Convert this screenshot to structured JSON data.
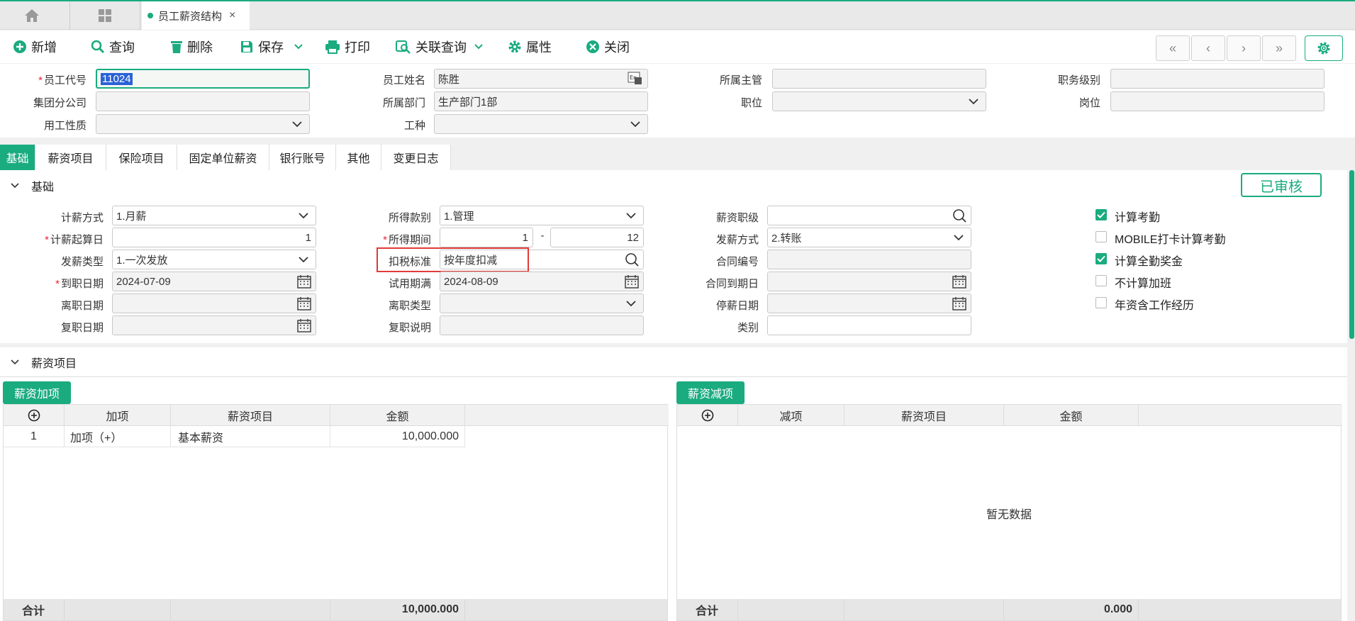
{
  "tabs": {
    "home_icon": "home-icon",
    "grid_icon": "grid-icon",
    "active_label": "员工薪资结构",
    "close_glyph": "×"
  },
  "toolbar": {
    "new_label": "新增",
    "query_label": "查询",
    "delete_label": "删除",
    "save_label": "保存",
    "print_label": "打印",
    "related_query_label": "关联查询",
    "properties_label": "属性",
    "close_label": "关闭",
    "nav": [
      "«",
      "‹",
      "›",
      "»"
    ]
  },
  "header": {
    "employee_code_label": "员工代号",
    "employee_code_value": "11024",
    "employee_name_label": "员工姓名",
    "employee_name_value": "陈胜",
    "supervisor_label": "所属主管",
    "supervisor_value": "",
    "job_level_label": "职务级别",
    "job_level_value": "",
    "branch_label": "集团分公司",
    "branch_value": "",
    "dept_label": "所属部门",
    "dept_value": "生产部门1部",
    "position_label": "职位",
    "position_value": "",
    "post_label": "岗位",
    "post_value": "",
    "employment_type_label": "用工性质",
    "employment_type_value": "",
    "work_type_label": "工种",
    "work_type_value": ""
  },
  "subtabs": [
    "基础",
    "薪资项目",
    "保险项目",
    "固定单位薪资",
    "银行账号",
    "其他",
    "变更日志"
  ],
  "basic": {
    "section_title": "基础",
    "status_label": "已审核",
    "pay_method_label": "计薪方式",
    "pay_method_value": "1.月薪",
    "pay_start_day_label": "计薪起算日",
    "pay_start_day_value": "1",
    "pay_type_label": "发薪类型",
    "pay_type_value": "1.一次发放",
    "entry_date_label": "到职日期",
    "entry_date_value": "2024-07-09",
    "leave_date_label": "离职日期",
    "leave_date_value": "",
    "rejoin_date_label": "复职日期",
    "rejoin_date_value": "",
    "income_category_label": "所得款别",
    "income_category_value": "1.管理",
    "income_period_label": "所得期间",
    "income_period_from": "1",
    "income_period_sep": "-",
    "income_period_to": "12",
    "tax_standard_label": "扣税标准",
    "tax_standard_value": "按年度扣减",
    "probation_end_label": "试用期满",
    "probation_end_value": "2024-08-09",
    "leave_type_label": "离职类型",
    "leave_type_value": "",
    "rejoin_note_label": "复职说明",
    "rejoin_note_value": "",
    "salary_grade_label": "薪资职级",
    "salary_grade_value": "",
    "pay_way_label": "发薪方式",
    "pay_way_value": "2.转账",
    "contract_no_label": "合同编号",
    "contract_no_value": "",
    "contract_end_label": "合同到期日",
    "contract_end_value": "",
    "stop_pay_date_label": "停薪日期",
    "stop_pay_date_value": "",
    "category_label": "类别",
    "category_value": "",
    "checkboxes": [
      {
        "label": "计算考勤",
        "checked": true
      },
      {
        "label": "MOBILE打卡计算考勤",
        "checked": false
      },
      {
        "label": "计算全勤奖金",
        "checked": true
      },
      {
        "label": "不计算加班",
        "checked": false
      },
      {
        "label": "年资含工作经历",
        "checked": false
      }
    ]
  },
  "salary": {
    "section_title": "薪资项目",
    "add_button": "薪资加项",
    "deduct_button": "薪资减项",
    "add_columns": [
      "加项",
      "薪资项目",
      "金额"
    ],
    "deduct_columns": [
      "减项",
      "薪资项目",
      "金额"
    ],
    "add_rows": [
      {
        "no": "1",
        "type": "加项（+）",
        "item": "基本薪资",
        "amount": "10,000.000"
      }
    ],
    "deduct_empty": "暂无数据",
    "total_label": "合计",
    "add_total": "10,000.000",
    "deduct_total": "0.000"
  },
  "colors": {
    "accent": "#1aab7f",
    "required": "#e23a3a",
    "highlight_box": "#e23a3a"
  }
}
